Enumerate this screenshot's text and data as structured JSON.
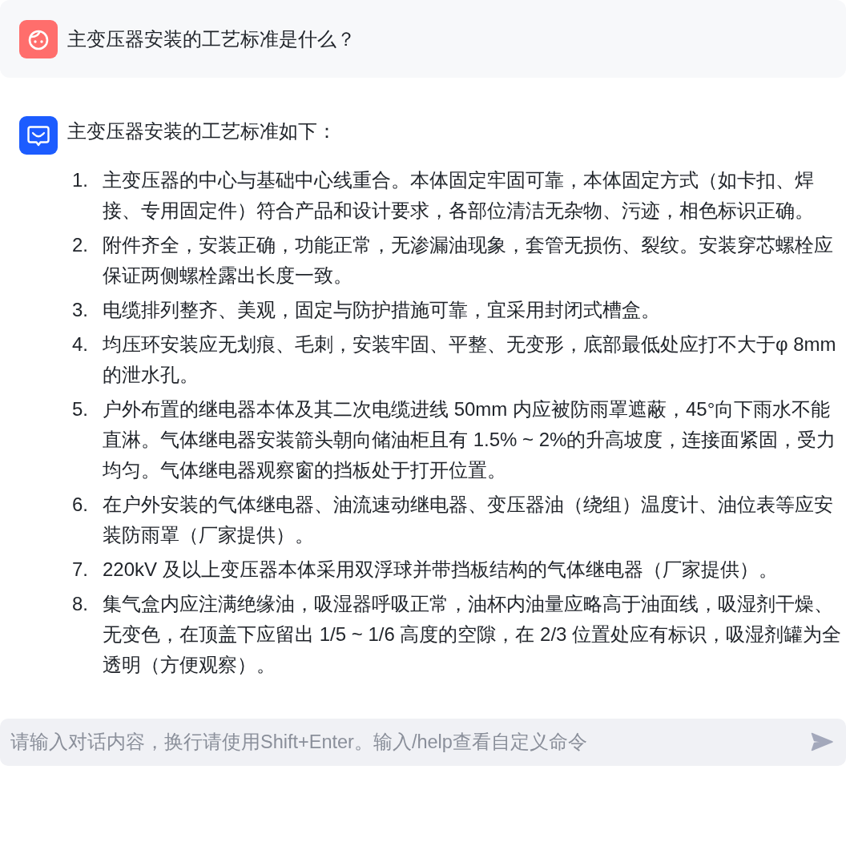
{
  "messages": [
    {
      "kind": "user",
      "text": "主变压器安装的工艺标准是什么？"
    },
    {
      "kind": "assistant",
      "text": "主变压器安装的工艺标准如下：",
      "list": [
        {
          "number": "1.",
          "text": "主变压器的中心与基础中心线重合。本体固定牢固可靠，本体固定方式（如卡扣、焊接、专用固定件）符合产品和设计要求，各部位清洁无杂物、污迹，相色标识正确。"
        },
        {
          "number": "2.",
          "text": "附件齐全，安装正确，功能正常，无渗漏油现象，套管无损伤、裂纹。安装穿芯螺栓应保证两侧螺栓露出长度一致。"
        },
        {
          "number": "3.",
          "text": "电缆排列整齐、美观，固定与防护措施可靠，宜采用封闭式槽盒。"
        },
        {
          "number": "4.",
          "text": "均压环安装应无划痕、毛刺，安装牢固、平整、无变形，底部最低处应打不大于φ 8mm的泄水孔。"
        },
        {
          "number": "5.",
          "text": "户外布置的继电器本体及其二次电缆进线 50mm 内应被防雨罩遮蔽，45°向下雨水不能直淋。气体继电器安装箭头朝向储油柜且有 1.5% ~ 2%的升高坡度，连接面紧固，受力均匀。气体继电器观察窗的挡板处于打开位置。"
        },
        {
          "number": "6.",
          "text": "在户外安装的气体继电器、油流速动继电器、变压器油（绕组）温度计、油位表等应安装防雨罩（厂家提供）。"
        },
        {
          "number": "7.",
          "text": "220kV 及以上变压器本体采用双浮球并带挡板结构的气体继电器（厂家提供）。"
        },
        {
          "number": "8.",
          "text": "集气盒内应注满绝缘油，吸湿器呼吸正常，油杯内油量应略高于油面线，吸湿剂干燥、无变色，在顶盖下应留出 1/5 ~ 1/6 高度的空隙，在 2/3 位置处应有标识，吸湿剂罐为全透明（方便观察）。"
        }
      ]
    }
  ],
  "input": {
    "placeholder": "请输入对话内容，换行请使用Shift+Enter。输入/help查看自定义命令"
  }
}
